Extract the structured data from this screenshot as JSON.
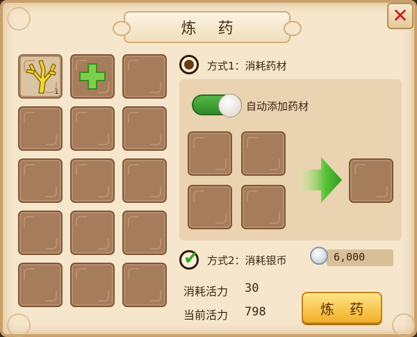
{
  "window": {
    "title": "炼 药",
    "close_symbol": "✕"
  },
  "inventory": {
    "slots": [
      {
        "item": "coral-herb-icon",
        "count": "1"
      },
      {
        "item": "plus-icon"
      },
      {},
      {},
      {},
      {},
      {},
      {},
      {},
      {},
      {},
      {},
      {},
      {},
      {}
    ]
  },
  "method1": {
    "label": "方式1：消耗药材",
    "selected": false,
    "auto_add_label": "自动添加药材",
    "auto_add_on": true
  },
  "method2": {
    "label": "方式2：消耗银币",
    "selected": true,
    "silver_cost": "6,000"
  },
  "stats": {
    "consume_label": "消耗活力",
    "consume_value": "30",
    "current_label": "当前活力",
    "current_value": "798"
  },
  "action_button": "炼 药",
  "colors": {
    "accent_green": "#36a82a",
    "button_gold": "#f2b02a",
    "close_red": "#c81a14"
  }
}
